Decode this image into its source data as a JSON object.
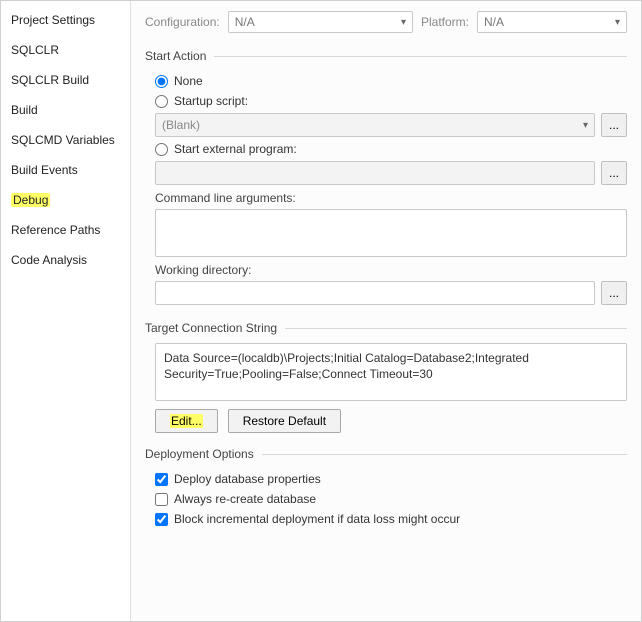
{
  "sidebar": {
    "items": [
      {
        "label": "Project Settings"
      },
      {
        "label": "SQLCLR"
      },
      {
        "label": "SQLCLR Build"
      },
      {
        "label": "Build"
      },
      {
        "label": "SQLCMD Variables"
      },
      {
        "label": "Build Events"
      },
      {
        "label": "Debug"
      },
      {
        "label": "Reference Paths"
      },
      {
        "label": "Code Analysis"
      }
    ]
  },
  "topbar": {
    "configuration_label": "Configuration:",
    "configuration_value": "N/A",
    "platform_label": "Platform:",
    "platform_value": "N/A"
  },
  "start_action": {
    "title": "Start Action",
    "none_label": "None",
    "startup_script_label": "Startup script:",
    "startup_script_value": "(Blank)",
    "external_program_label": "Start external program:",
    "external_program_value": "",
    "cmdline_label": "Command line arguments:",
    "cmdline_value": "",
    "workdir_label": "Working directory:",
    "workdir_value": "",
    "ellipsis": "..."
  },
  "target_conn": {
    "title": "Target Connection String",
    "value": "Data Source=(localdb)\\Projects;Initial Catalog=Database2;Integrated Security=True;Pooling=False;Connect Timeout=30",
    "edit_label": "Edit...",
    "restore_label": "Restore Default"
  },
  "deployment": {
    "title": "Deployment Options",
    "deploy_props_label": "Deploy database properties",
    "deploy_props_checked": true,
    "recreate_label": "Always re-create database",
    "recreate_checked": false,
    "block_label": "Block incremental deployment if data loss might occur",
    "block_checked": true
  }
}
